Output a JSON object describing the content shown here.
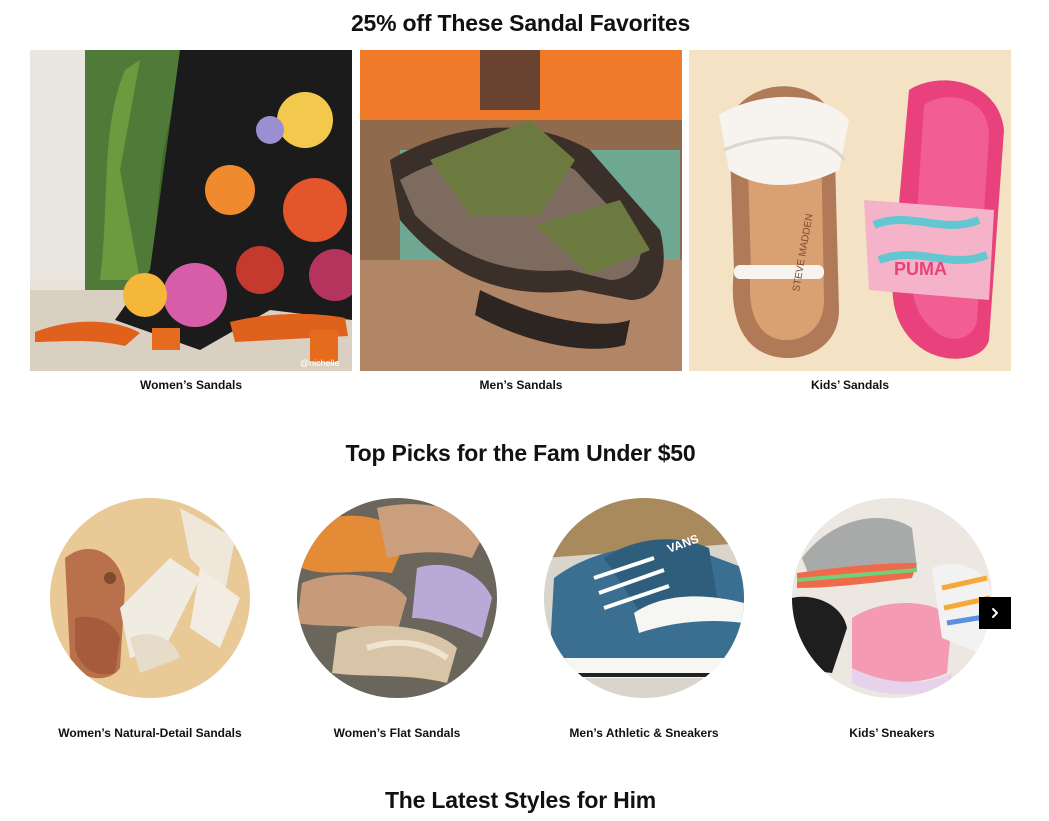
{
  "sections": {
    "sale": {
      "title": "25% off These Sandal Favorites",
      "tiles": [
        {
          "label": "Women’s Sandals",
          "watermark": "@nichelle"
        },
        {
          "label": "Men’s Sandals"
        },
        {
          "label": "Kids’ Sandals",
          "brand_text": "STEVE MADDEN",
          "brand_text_2": "PUMA"
        }
      ]
    },
    "top_picks": {
      "title": "Top Picks for the Fam Under $50",
      "items": [
        {
          "label": "Women’s Natural-Detail Sandals"
        },
        {
          "label": "Women’s Flat Sandals"
        },
        {
          "label": "Men’s Athletic & Sneakers",
          "brand_text": "VANS"
        },
        {
          "label": "Kids’ Sneakers"
        }
      ],
      "next_icon": "chevron-right-icon"
    },
    "latest": {
      "title": "The Latest Styles for Him"
    }
  }
}
